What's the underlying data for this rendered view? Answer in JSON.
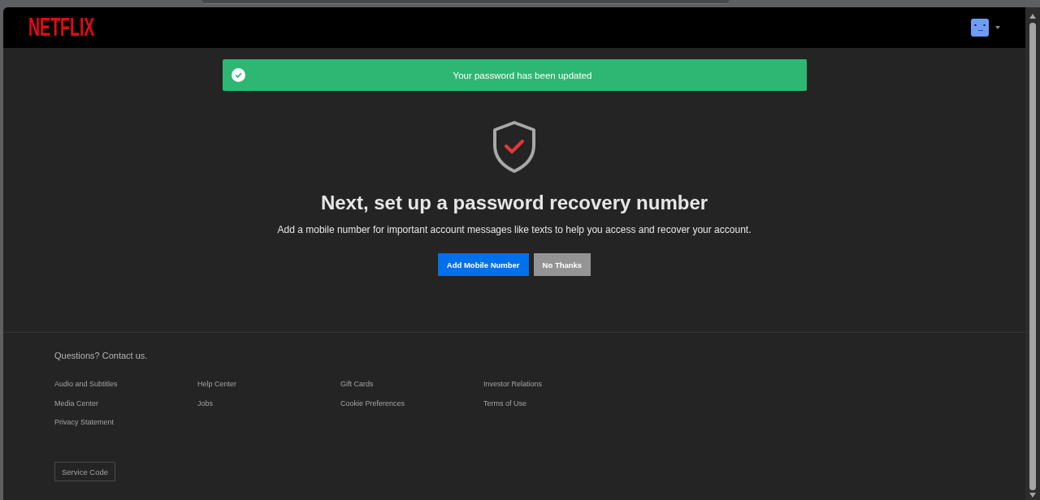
{
  "header": {
    "logo": "NETFLIX"
  },
  "banner": {
    "message": "Your password has been updated"
  },
  "prompt": {
    "heading": "Next, set up a password recovery number",
    "description": "Add a mobile number for important account messages like texts to help you access and recover your account.",
    "buttons": [
      {
        "label": "Add Mobile Number",
        "kind": "primary"
      },
      {
        "label": "No Thanks",
        "kind": "secondary"
      }
    ]
  },
  "footer": {
    "contact": "Questions? Contact us.",
    "links": [
      "Audio and Subtitles",
      "Help Center",
      "Gift Cards",
      "Investor Relations",
      "Media Center",
      "Jobs",
      "Cookie Preferences",
      "Terms of Use",
      "Privacy Statement"
    ],
    "service_code": "Service Code"
  }
}
